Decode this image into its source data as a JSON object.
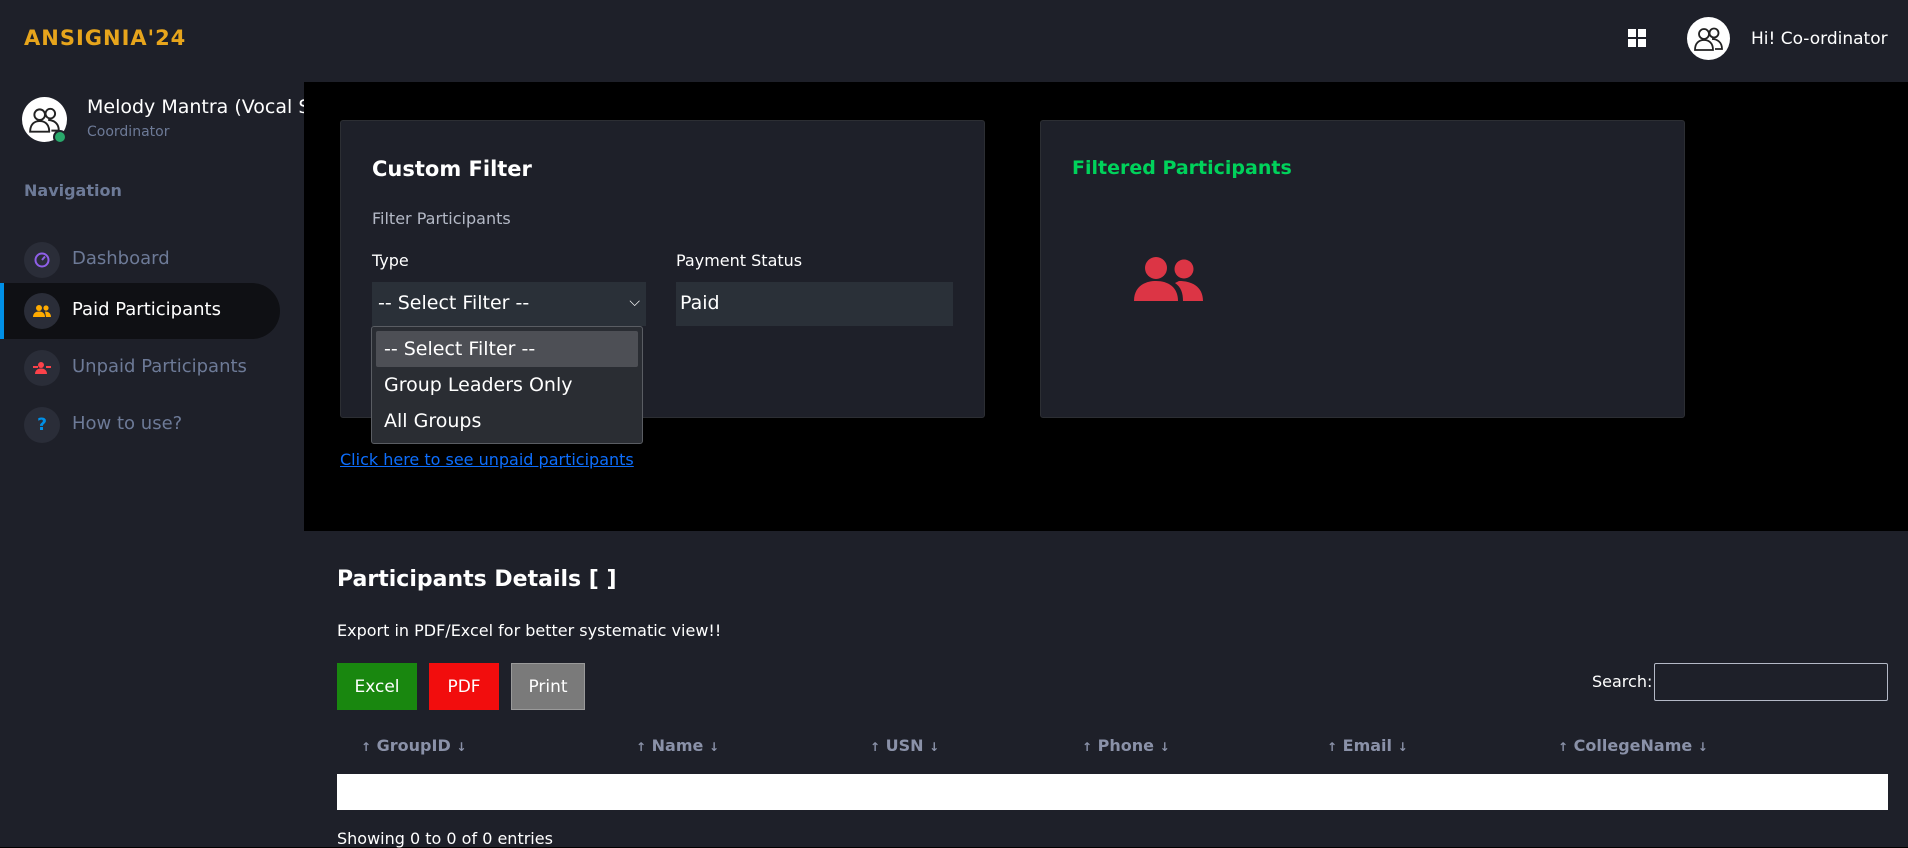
{
  "app": {
    "logo": "ANSIGNIA'24",
    "greeting": "Hi! Co-ordinator"
  },
  "sidebar": {
    "profile_name": "Melody Mantra (Vocal Solo)",
    "profile_role": "Coordinator",
    "nav_title": "Navigation",
    "items": [
      {
        "label": "Dashboard",
        "icon": "speedometer-icon",
        "color": "#8f5fe8",
        "active": false
      },
      {
        "label": "Paid Participants",
        "icon": "people-icon",
        "color": "#ffab00",
        "active": true
      },
      {
        "label": "Unpaid Participants",
        "icon": "person-minus-icon",
        "color": "#fc424a",
        "active": false
      },
      {
        "label": "How to use?",
        "icon": "question-icon",
        "color": "#0090e7",
        "active": false
      }
    ]
  },
  "filter": {
    "title": "Custom Filter",
    "subtitle": "Filter Participants",
    "type_label": "Type",
    "type_value": "-- Select Filter --",
    "type_options": [
      "-- Select Filter --",
      "Group Leaders Only",
      "All Groups"
    ],
    "payment_label": "Payment Status",
    "payment_value": "Paid"
  },
  "participants_card": {
    "title": "Filtered Participants",
    "icon_color": "#dc3545"
  },
  "unpaid_link": "Click here to see unpaid participants",
  "details": {
    "title": "Participants Details [ ]",
    "subtitle": "Export in PDF/Excel for better systematic view!!",
    "buttons": {
      "excel": "Excel",
      "pdf": "PDF",
      "print": "Print"
    },
    "search_label": "Search:",
    "columns": [
      "GroupID",
      "Name",
      "USN",
      "Phone",
      "Email",
      "CollegeName"
    ],
    "footer": "Showing 0 to 0 of 0 entries"
  },
  "colors": {
    "accent": "#0090e7",
    "logo": "#e7a51c",
    "success": "#00d25b",
    "excel": "#19870f",
    "pdf": "#f20d0d"
  }
}
